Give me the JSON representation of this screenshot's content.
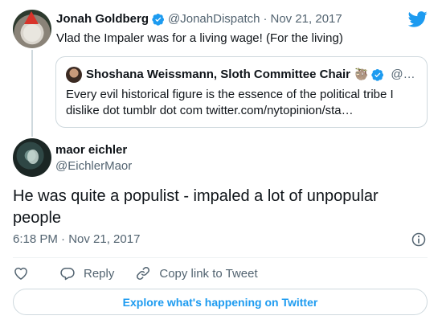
{
  "parent_tweet": {
    "name": "Jonah Goldberg",
    "handle": "@JonahDispatch",
    "separator": "·",
    "date": "Nov 21, 2017",
    "text": "Vlad the Impaler was for a living wage! (For the living)"
  },
  "quoted_tweet": {
    "name": "Shoshana Weissmann, Sloth Committee Chair",
    "name_emoji": "🦥",
    "handle": "@…",
    "text": "Every evil historical figure is the essence of the political tribe I dislike dot tumblr dot com twitter.com/nytopinion/sta…"
  },
  "main_tweet": {
    "name": "maor eichler",
    "handle": "@EichlerMaor",
    "text": "He was quite a populist - impaled a lot of unpopular people",
    "timestamp": "6:18 PM · Nov 21, 2017"
  },
  "actions": {
    "reply_label": "Reply",
    "copy_label": "Copy link to Tweet"
  },
  "footer": {
    "explore_label": "Explore what's happening on Twitter"
  },
  "colors": {
    "brand_blue": "#1d9bf0",
    "text_primary": "#0f1419",
    "text_secondary": "#536471",
    "border": "#cfd9de"
  },
  "icons": [
    "twitter-bird-icon",
    "verified-badge-icon",
    "info-icon",
    "heart-icon",
    "reply-icon",
    "link-icon"
  ]
}
